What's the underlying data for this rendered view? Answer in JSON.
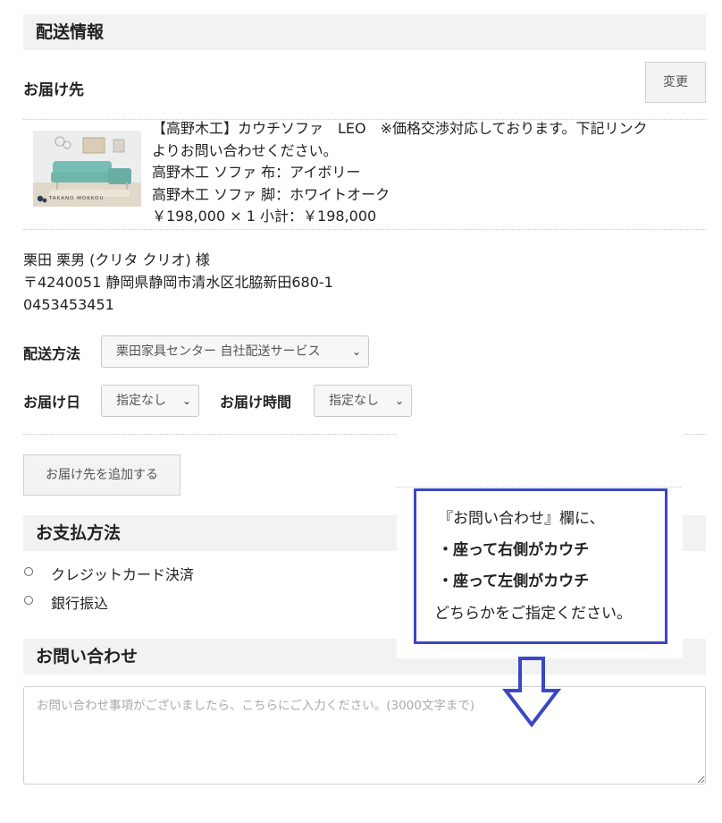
{
  "shipping": {
    "section_title": "配送情報",
    "destination_label": "お届け先",
    "change_button": "変更",
    "product": {
      "line1": "【高野木工】カウチソファ　LEO　※価格交渉対応しております。下記リンク",
      "line2": "よりお問い合わせください。",
      "option1": "高野木工 ソファ 布：アイボリー",
      "option2": "高野木工 ソファ 脚：ホワイトオーク",
      "price_line": "￥198,000 × 1  小計：￥198,000",
      "thumb_brand": "TAKANO MOKKOU"
    },
    "recipient": {
      "name": "栗田 栗男 (クリタ クリオ) 様",
      "address": "〒4240051 静岡県静岡市清水区北脇新田680-1",
      "phone": "0453453451"
    },
    "method_label": "配送方法",
    "method_value": "栗田家具センター 自社配送サービス",
    "date_label": "お届け日",
    "date_value": "指定なし",
    "time_label": "お届け時間",
    "time_value": "指定なし",
    "add_destination_button": "お届け先を追加する"
  },
  "payment": {
    "section_title": "お支払方法",
    "options": [
      "クレジットカード決済",
      "銀行振込"
    ]
  },
  "inquiry": {
    "section_title": "お問い合わせ",
    "placeholder": "お問い合わせ事項がございましたら、こちらにご入力ください。(3000文字まで)"
  },
  "annotation": {
    "line1": "『お問い合わせ』欄に、",
    "line2": "・座って右側がカウチ",
    "line3": "・座って左側がカウチ",
    "line4": "どちらかをご指定ください。",
    "border_color": "#3b47c4"
  }
}
